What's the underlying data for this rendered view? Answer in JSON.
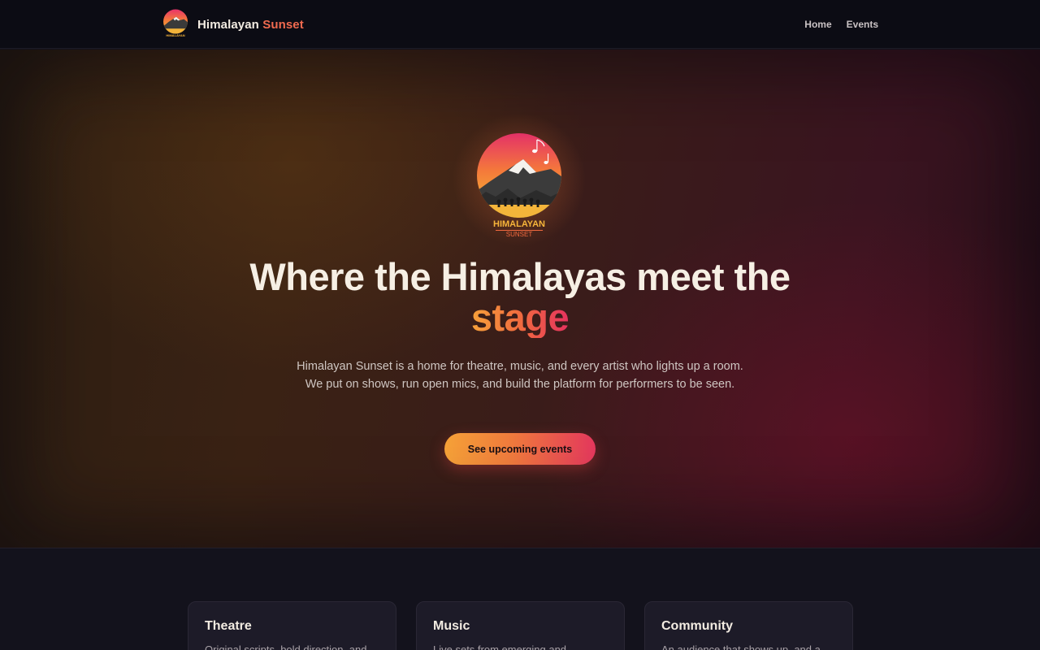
{
  "nav": {
    "brand": {
      "name_main": "Himalayan",
      "name_accent": "Sunset"
    },
    "links": [
      {
        "label": "Home"
      },
      {
        "label": "Events"
      }
    ]
  },
  "hero": {
    "logo": {
      "text_top": "HIMALAYAN",
      "text_bottom": "SUNSET"
    },
    "title_main": "Where the Himalayas meet the",
    "title_accent": "stage",
    "description": "Himalayan Sunset is a home for theatre, music, and every artist who lights up a room. We put on shows, run open mics, and build the platform for performers to be seen.",
    "cta_label": "See upcoming events"
  },
  "features": [
    {
      "title": "Theatre",
      "text": "Original scripts, bold direction, and"
    },
    {
      "title": "Music",
      "text": "Live sets from emerging and"
    },
    {
      "title": "Community",
      "text": "An audience that shows up, and a"
    }
  ],
  "colors": {
    "accent_orange": "#f6a238",
    "accent_pink": "#e4385d",
    "nav_bg": "#0c0c14",
    "card_bg": "#1d1b28"
  }
}
